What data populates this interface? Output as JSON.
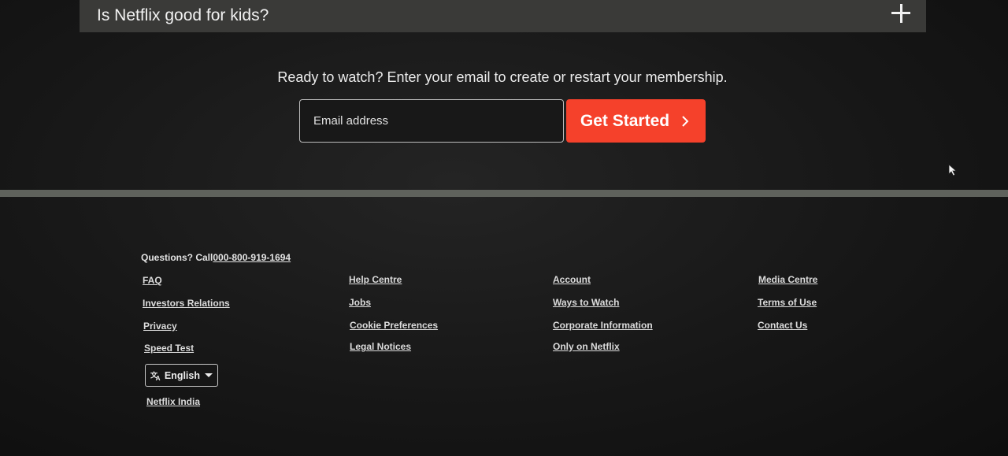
{
  "faq": {
    "question": "Is Netflix good for kids?",
    "expand_icon": "plus-icon"
  },
  "signup": {
    "prompt": "Ready to watch? Enter your email to create or restart your membership.",
    "email_placeholder": "Email address",
    "button_label": "Get Started",
    "button_icon": "chevron-right-icon"
  },
  "colors": {
    "brand_red": "#f5412b",
    "background": "#141414",
    "faq_bg": "#3a3a38"
  },
  "footer": {
    "questions_prefix": "Questions? Call",
    "phone": "000-800-919-1694",
    "columns": [
      [
        "FAQ",
        "Investors Relations",
        "Privacy",
        "Speed Test"
      ],
      [
        "Help Centre",
        "Jobs",
        "Cookie Preferences",
        "Legal Notices"
      ],
      [
        "Account",
        "Ways to Watch",
        "Corporate Information",
        "Only on Netflix"
      ],
      [
        "Media Centre",
        "Terms of Use",
        "Contact Us"
      ]
    ],
    "language": {
      "selected": "English",
      "icon": "translate-icon"
    },
    "region": "Netflix India"
  }
}
